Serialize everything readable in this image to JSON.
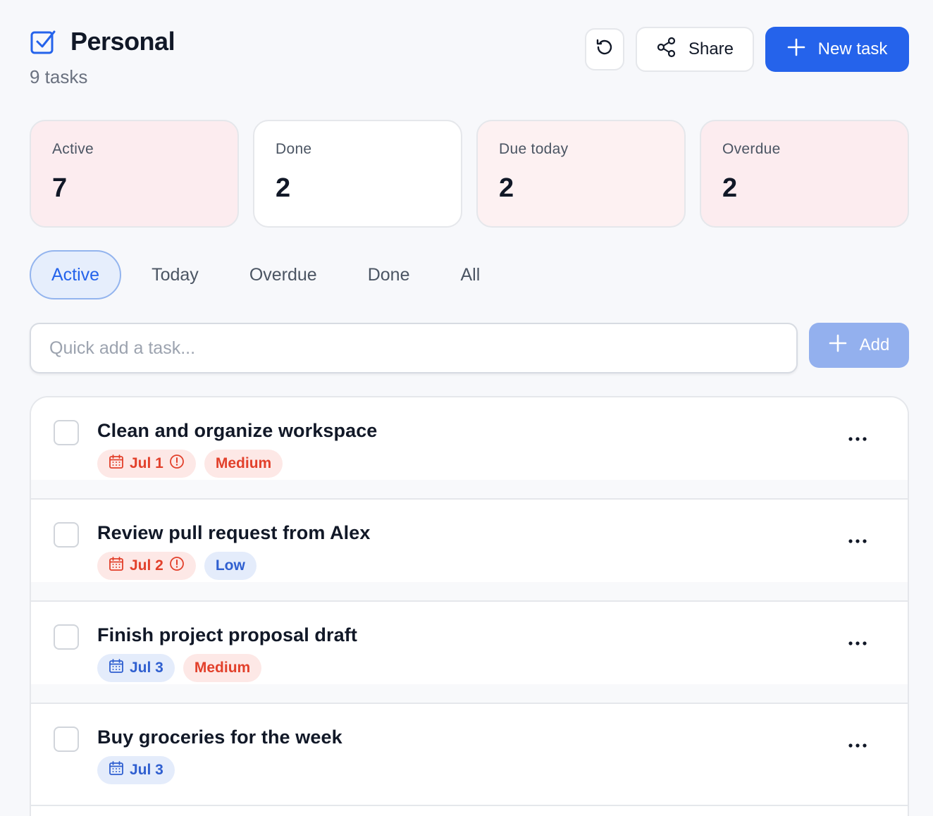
{
  "header": {
    "title": "Personal",
    "subtitle": "9 tasks",
    "share_label": "Share",
    "new_task_label": "New task",
    "accent": "#2563eb"
  },
  "stats": [
    {
      "label": "Active",
      "value": "7",
      "tone": "pink"
    },
    {
      "label": "Done",
      "value": "2",
      "tone": "white"
    },
    {
      "label": "Due today",
      "value": "2",
      "tone": "rose"
    },
    {
      "label": "Overdue",
      "value": "2",
      "tone": "pink"
    }
  ],
  "tabs": [
    {
      "label": "Active",
      "active": true
    },
    {
      "label": "Today",
      "active": false
    },
    {
      "label": "Overdue",
      "active": false
    },
    {
      "label": "Done",
      "active": false
    },
    {
      "label": "All",
      "active": false
    }
  ],
  "quick_add": {
    "placeholder": "Quick add a task...",
    "button_label": "Add"
  },
  "tasks": [
    {
      "title": "Clean and organize workspace",
      "due": "Jul 1",
      "due_status": "overdue",
      "priority": "Medium",
      "priority_tone": "red"
    },
    {
      "title": "Review pull request from Alex",
      "due": "Jul 2",
      "due_status": "overdue",
      "priority": "Low",
      "priority_tone": "blue"
    },
    {
      "title": "Finish project proposal draft",
      "due": "Jul 3",
      "due_status": "normal",
      "priority": "Medium",
      "priority_tone": "red"
    },
    {
      "title": "Buy groceries for the week",
      "due": "Jul 3",
      "due_status": "normal",
      "priority": "",
      "priority_tone": ""
    }
  ],
  "icons": {
    "title": "checkbox-icon",
    "reset": "refresh-icon",
    "share": "share-icon",
    "add": "plus-icon",
    "calendar": "calendar-icon",
    "alert": "alert-circle-icon",
    "more": "more-horizontal-icon"
  }
}
